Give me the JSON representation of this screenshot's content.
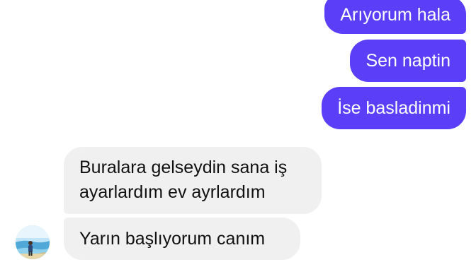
{
  "messages": {
    "outgoing": [
      {
        "text": "Arıyorum hala"
      },
      {
        "text": "Sen naptin"
      },
      {
        "text": "İse basladinmi"
      }
    ],
    "incoming": [
      {
        "text": "Buralara gelseydin sana iş ayarlardım ev ayrlardım"
      },
      {
        "text": "Yarın başlıyorum canım"
      }
    ]
  },
  "colors": {
    "outgoing_bubble": "#5b3ff8",
    "incoming_bubble": "#f1f0f0",
    "outgoing_text": "#ffffff",
    "incoming_text": "#111111"
  },
  "icons": {
    "contact_avatar": "avatar-photo-icon"
  }
}
